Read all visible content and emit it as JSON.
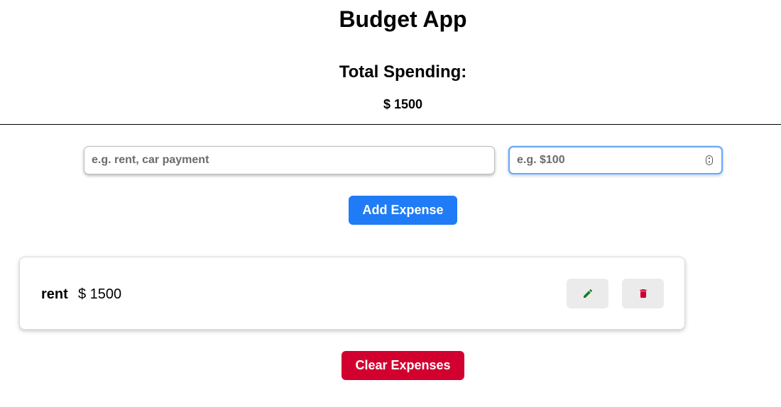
{
  "app": {
    "title": "Budget App"
  },
  "summary": {
    "heading": "Total Spending:",
    "currency": "$",
    "total": "1500"
  },
  "form": {
    "name_placeholder": "e.g. rent, car payment",
    "amount_placeholder": "e.g. $100",
    "add_label": "Add Expense"
  },
  "expenses": [
    {
      "name": "rent",
      "amount": "$ 1500",
      "edit_icon": "pencil-icon",
      "delete_icon": "trash-icon"
    }
  ],
  "footer": {
    "clear_label": "Clear Expenses"
  },
  "colors": {
    "primary": "#1f7cf6",
    "danger": "#d2002f",
    "edit_icon": "#1a7a1a",
    "delete_icon": "#d2002f",
    "icon_button_bg": "#ebebeb"
  }
}
